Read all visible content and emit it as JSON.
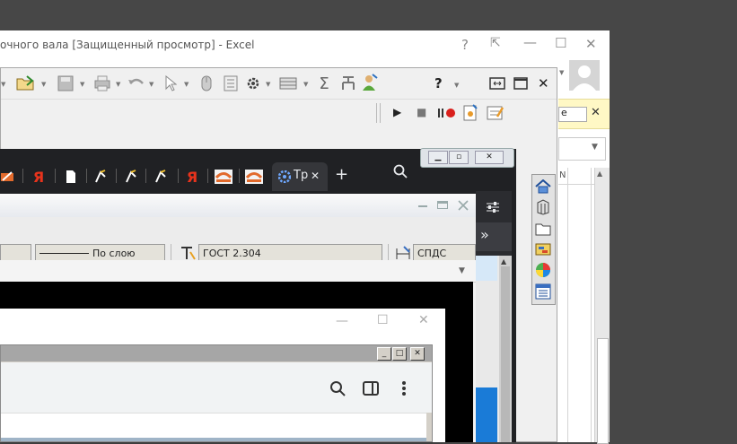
{
  "excel": {
    "title": "очного вала  [Защищенный просмотр] - Excel",
    "help": "?",
    "restore_ribbon": "⇱",
    "minimize": "—",
    "maximize": "☐",
    "close": "✕",
    "warn_close": "✕",
    "warn_text": "е",
    "header_fragment": "N"
  },
  "cad": {
    "help": "?",
    "close": "✕",
    "play": "▶",
    "stop": "■",
    "sigma": "Σ"
  },
  "browser": {
    "yandex": "Я",
    "active_tab_label": "Тр",
    "tab_close": "✕",
    "new_tab": "+",
    "more": "»",
    "win_min": "▁",
    "win_max": "▫",
    "win_close": "✕"
  },
  "inner": {
    "linetype": "По слою",
    "text_style": "ГОСТ 2.304",
    "dim_style": "СПДС"
  },
  "dialog": {
    "minimize": "—",
    "maximize": "☐",
    "close": "✕",
    "w98_min": "_",
    "w98_max": "□",
    "w98_close": "✕"
  }
}
